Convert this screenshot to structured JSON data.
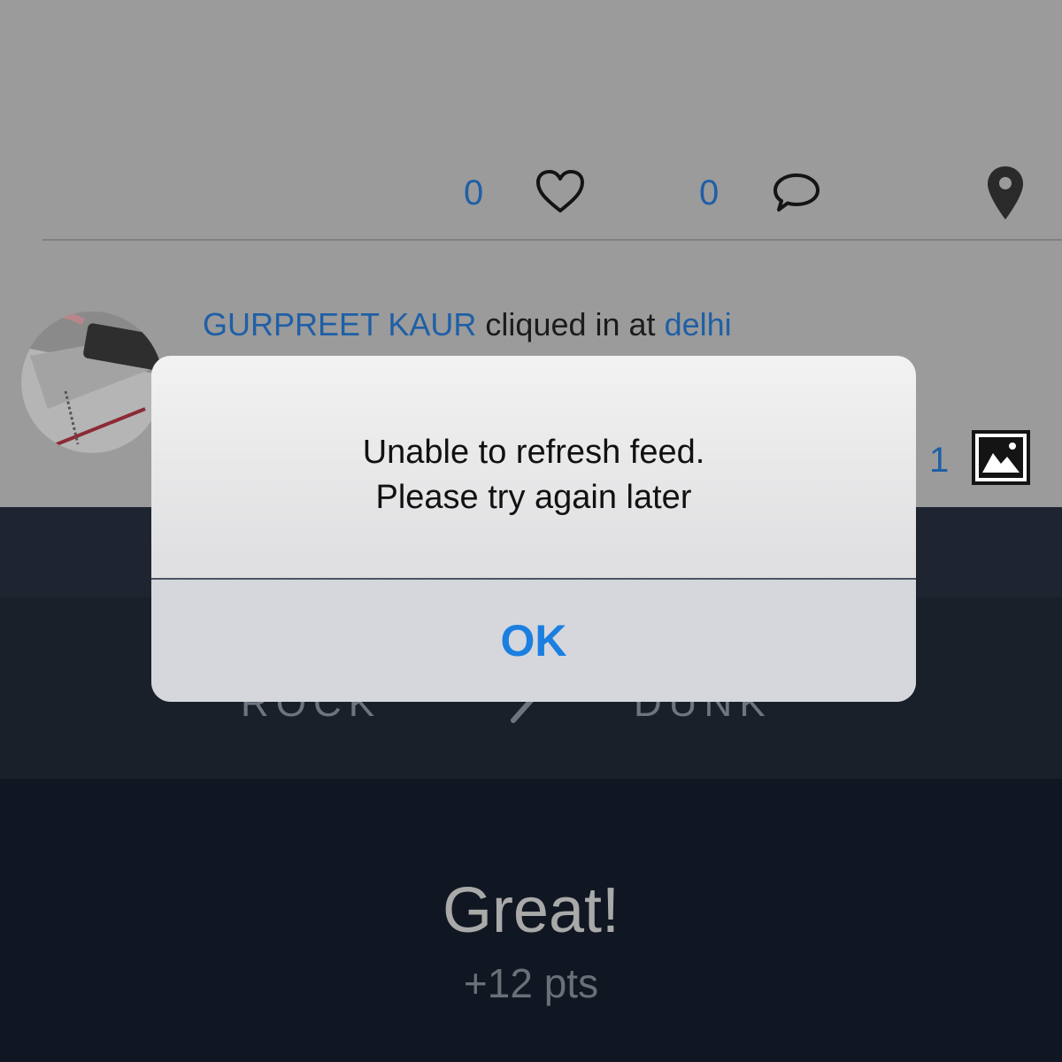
{
  "feed": {
    "likes_count": "0",
    "comments_count": "0",
    "post": {
      "user_name": "GURPREET KAUR",
      "action_text": "cliqued in at",
      "place": "delhi",
      "media_count": "1"
    }
  },
  "game": {
    "left_option": "ROCK",
    "right_option": "DUNK",
    "result_title": "Great!",
    "result_points": "+12 pts"
  },
  "alert": {
    "message_line1": "Unable to refresh feed.",
    "message_line2": "Please try again later",
    "ok_label": "OK"
  },
  "colors": {
    "link_blue": "#1f5fa6",
    "ios_blue": "#1a7fe0",
    "dim_gray": "#9b9b9b",
    "panel_dark": "#111722"
  },
  "icons": [
    "heart-icon",
    "comment-icon",
    "map-pin-icon",
    "image-icon",
    "arrow-icon"
  ]
}
